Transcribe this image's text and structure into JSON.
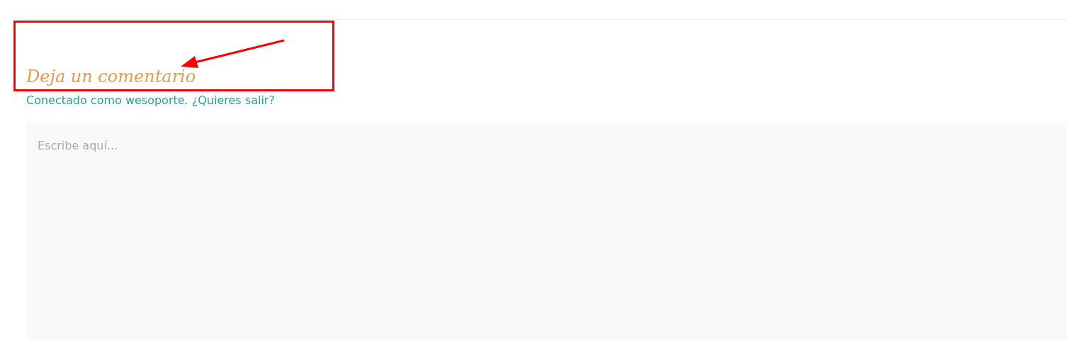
{
  "annotation": {
    "kind": "box-arrow"
  },
  "heading": "Deja un comentario",
  "logged_in": {
    "account_link": "Conectado como wesoporte.",
    "logout_link": "¿Quieres salir?"
  },
  "comment": {
    "placeholder": "Escribe aquí..."
  }
}
